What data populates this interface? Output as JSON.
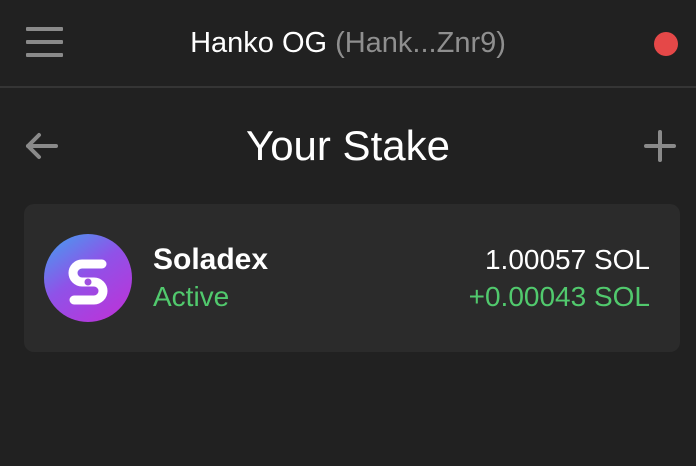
{
  "header": {
    "wallet_name": "Hanko OG",
    "wallet_address": "(Hank...Znr9)",
    "menu_icon": "hamburger-menu-icon",
    "status_icon": "connection-status-dot",
    "status_color": "#e54848"
  },
  "page": {
    "title": "Your Stake",
    "back_icon": "arrow-left-icon",
    "add_icon": "plus-icon"
  },
  "stakes": [
    {
      "validator": "Soladex",
      "logo_icon": "soladex-logo",
      "status": "Active",
      "amount": "1.00057 SOL",
      "rewards": "+0.00043 SOL"
    }
  ],
  "colors": {
    "background": "#212121",
    "card": "#2b2b2b",
    "positive": "#51c96d",
    "muted": "#8f8f8f"
  }
}
